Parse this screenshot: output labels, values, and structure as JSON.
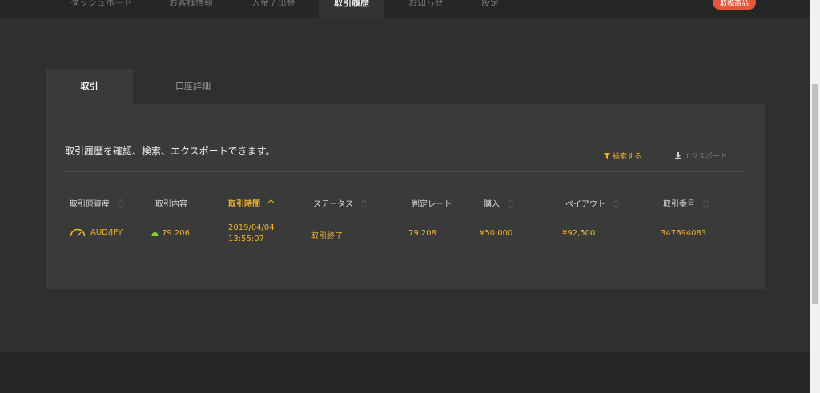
{
  "nav": {
    "items": [
      {
        "label": "ダッシュボード"
      },
      {
        "label": "お客様情報"
      },
      {
        "label": "入金 / 出金"
      },
      {
        "label": "取引履歴",
        "active": true
      },
      {
        "label": "お知らせ"
      },
      {
        "label": "設定"
      }
    ],
    "badge": "取扱商品"
  },
  "tabs": [
    {
      "label": "取引",
      "active": true
    },
    {
      "label": "口座詳細",
      "active": false
    }
  ],
  "panel": {
    "description": "取引履歴を確認、検索、エクスポートできます。",
    "search_label": "検索する",
    "export_label": "エクスポート"
  },
  "table": {
    "headers": [
      "取引原資産",
      "取引内容",
      "取引時間",
      "ステータス",
      "判定レート",
      "購入",
      "ペイアウト",
      "取引番号"
    ],
    "sorted_column": "取引時間",
    "rows": [
      {
        "asset": "AUD/JPY",
        "content": "79.206",
        "date": "2019/04/04",
        "time": "13:55:07",
        "status": "取引終了",
        "rate": "79.208",
        "purchase": "¥50,000",
        "payout": "¥92,500",
        "trade_no": "347694083"
      }
    ]
  },
  "colors": {
    "accent": "#f2b32a",
    "badge": "#e8553a",
    "up_arrow": "#7fd13b"
  }
}
